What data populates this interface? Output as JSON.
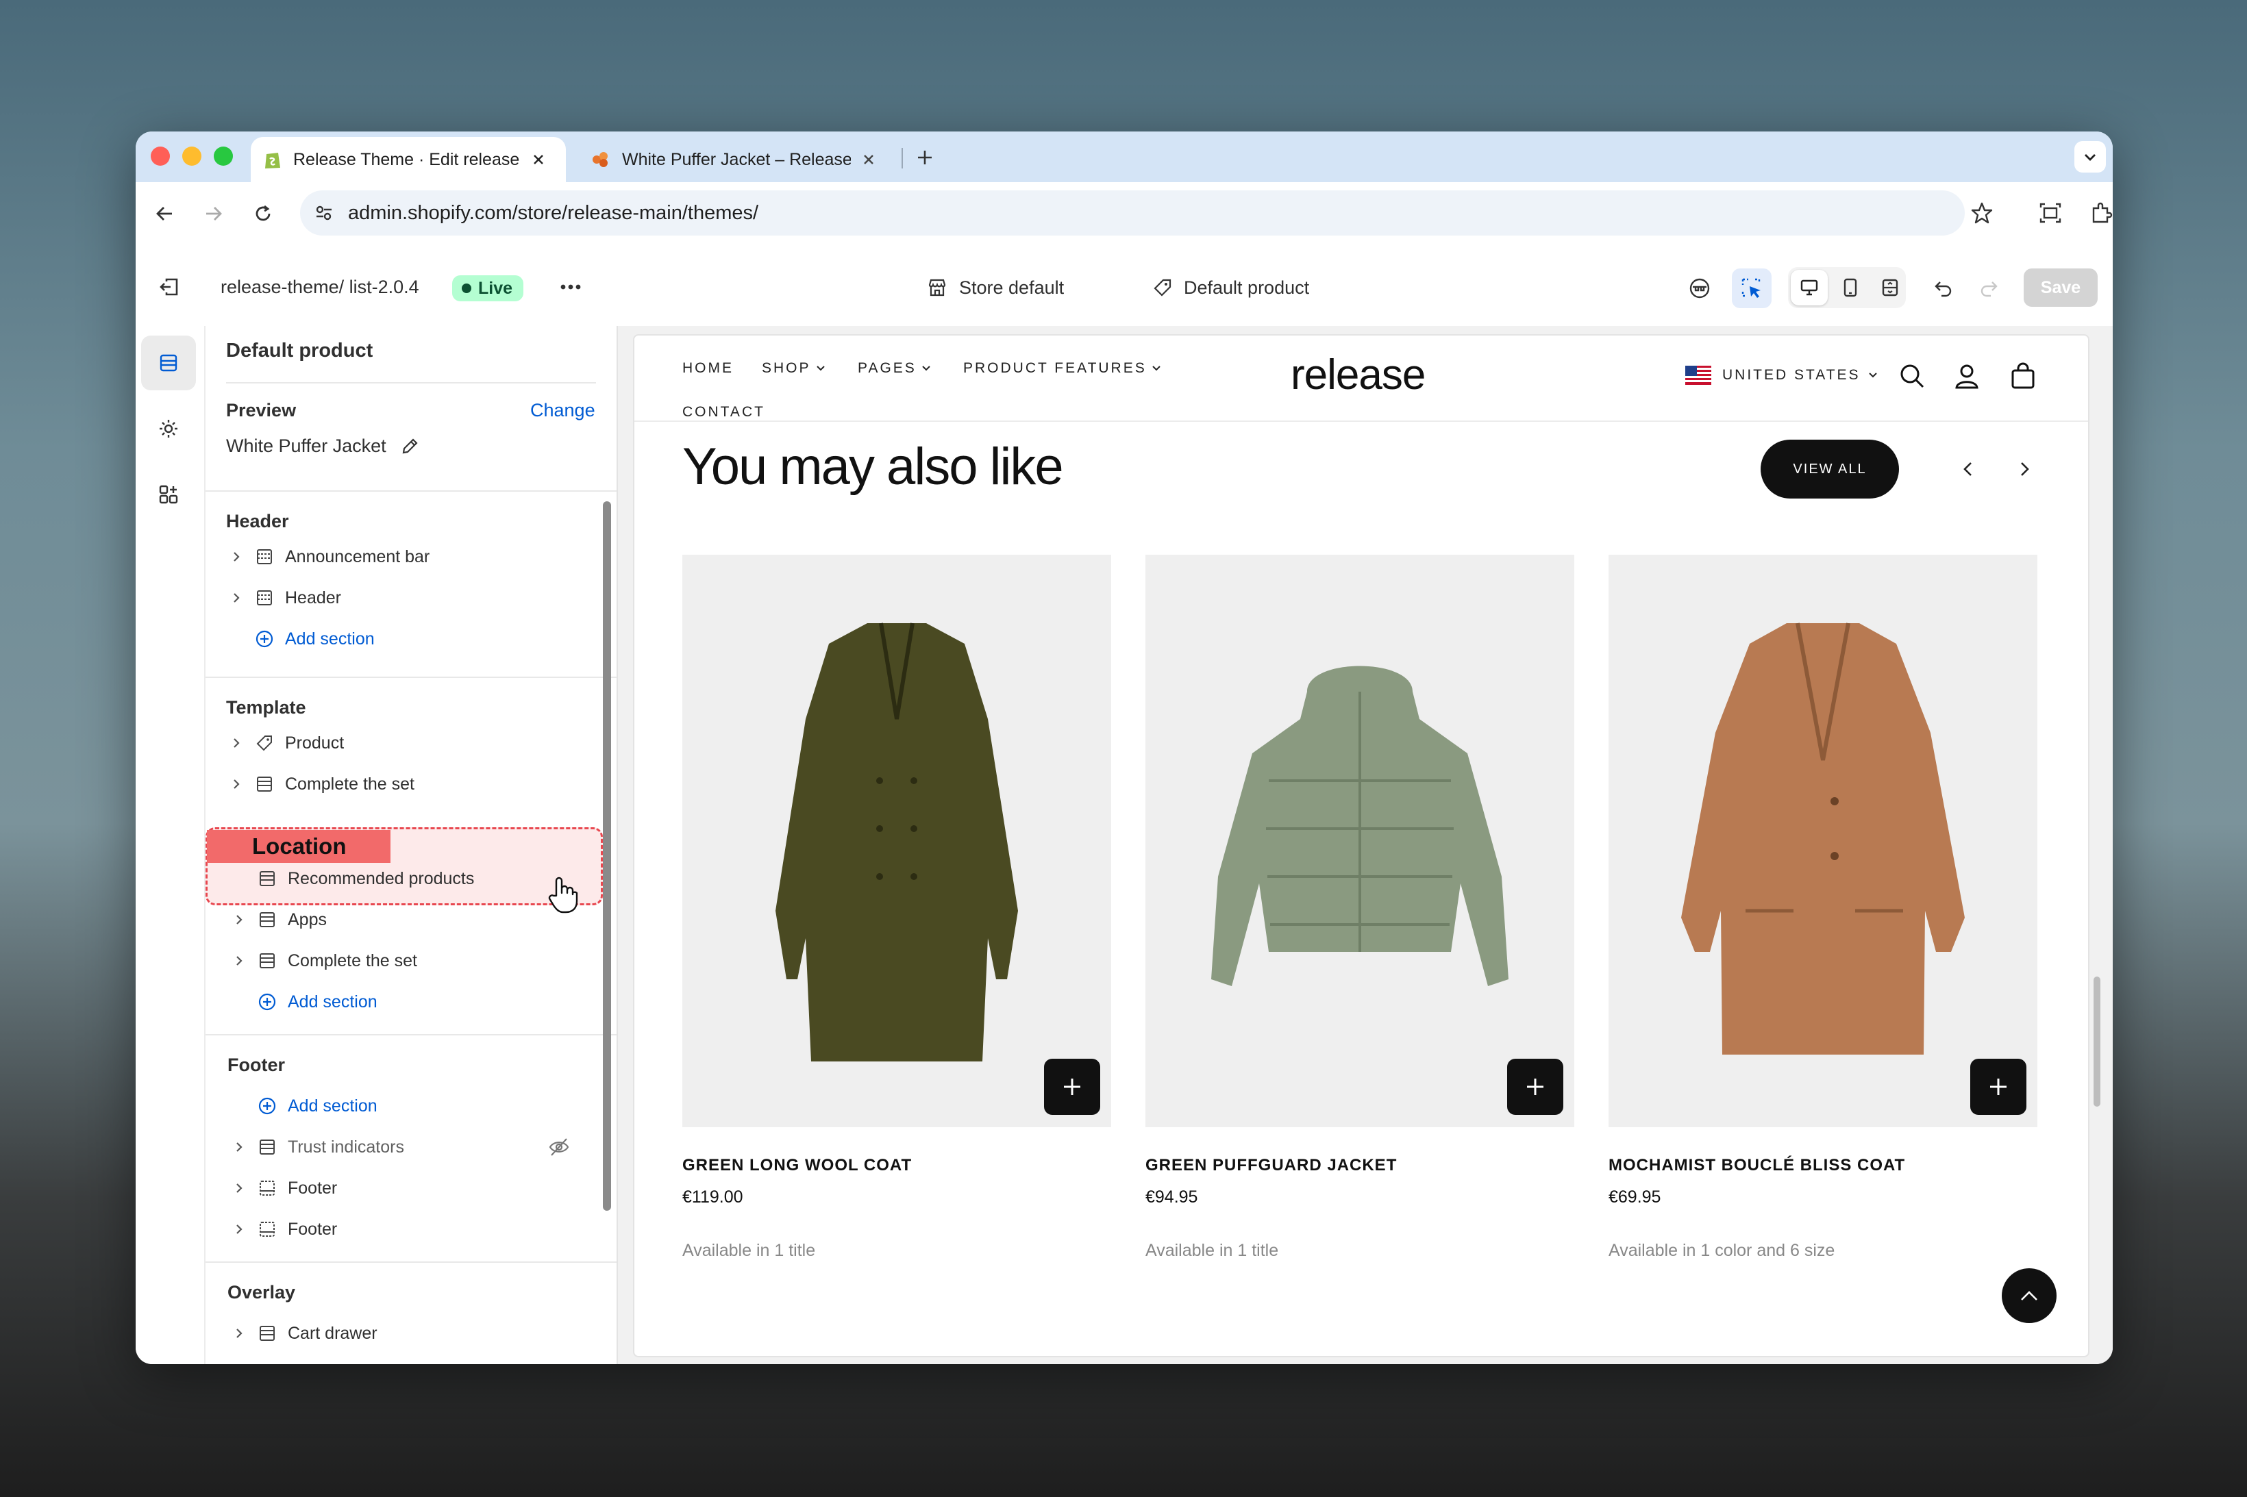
{
  "browser": {
    "tabs": [
      {
        "title": "Release Theme · Edit release"
      },
      {
        "title": "White Puffer Jacket – Release"
      }
    ],
    "url": "admin.shopify.com/store/release-main/themes/"
  },
  "editor": {
    "theme_path": "release-theme/ list-2.0.4",
    "live_badge": "Live",
    "store_default": "Store default",
    "default_product": "Default product",
    "save_label": "Save"
  },
  "sidebar": {
    "title": "Default product",
    "preview": {
      "label": "Preview",
      "change": "Change",
      "product": "White Puffer Jacket"
    },
    "header": {
      "title": "Header",
      "items": [
        "Announcement bar",
        "Header"
      ],
      "add": "Add section"
    },
    "template": {
      "title": "Template",
      "items": [
        "Product",
        "Complete the set",
        "Recommended products",
        "Apps",
        "Complete the set"
      ],
      "add": "Add section"
    },
    "footer": {
      "title": "Footer",
      "add": "Add section",
      "items": [
        "Trust indicators",
        "Footer",
        "Footer"
      ]
    },
    "overlay": {
      "title": "Overlay",
      "items": [
        "Cart drawer"
      ]
    },
    "location_label": "Location"
  },
  "store": {
    "nav": [
      "HOME",
      "SHOP",
      "PAGES",
      "PRODUCT FEATURES",
      "CONTACT"
    ],
    "logo": "release",
    "country": "UNITED STATES",
    "section_title": "You may also like",
    "view_all": "VIEW ALL",
    "products": [
      {
        "name": "GREEN LONG WOOL COAT",
        "price": "€119.00",
        "availability": "Available in 1 title",
        "color": "#4a4a22"
      },
      {
        "name": "GREEN PUFFGUARD JACKET",
        "price": "€94.95",
        "availability": "Available in 1 title",
        "color": "#8a9a80"
      },
      {
        "name": "MOCHAMIST BOUCLÉ BLISS COAT",
        "price": "€69.95",
        "availability": "Available in 1 color and 6 size",
        "color": "#b87a52"
      }
    ]
  },
  "colors": {
    "accent": "#005bd3",
    "live_bg": "#b4fed2",
    "highlight": "#f26a6a"
  }
}
